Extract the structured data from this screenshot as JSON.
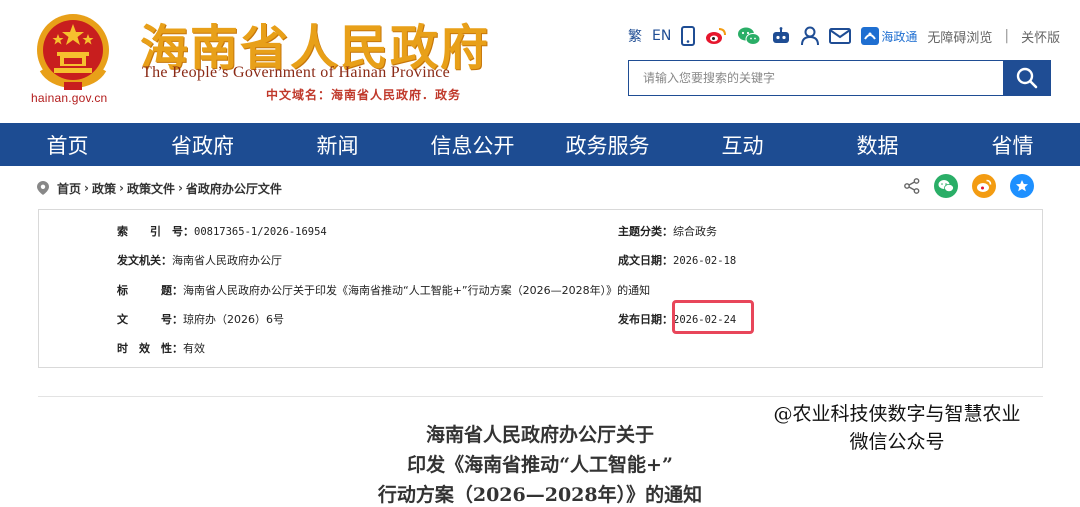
{
  "header": {
    "domain": "hainan.gov.cn",
    "brand_cn": "海南省人民政府",
    "brand_en": "The People’s Government  of Hainan Province",
    "cn_domain": "中文域名：海南省人民政府．政务",
    "toolbar": {
      "traditional": "繁",
      "english": "EN",
      "haizhengtong": "海政通",
      "accessible": "无障碍浏览",
      "separator": "|",
      "elder": "关怀版"
    },
    "search": {
      "placeholder": "请输入您要搜索的关键字"
    }
  },
  "nav": {
    "items": [
      "首页",
      "省政府",
      "新闻",
      "信息公开",
      "政务服务",
      "互动",
      "数据",
      "省情"
    ]
  },
  "breadcrumb": {
    "items": [
      "首页",
      "政策",
      "政策文件",
      "省政府办公厅文件"
    ],
    "arrow": "›"
  },
  "meta": {
    "index_label": "索　　引　号：",
    "index_value": "00817365-1/2026-16954",
    "issuer_label": "发文机关：",
    "issuer_value": "海南省人民政府办公厅",
    "title_label": "标　　　题：",
    "title_value": "海南省人民政府办公厅关于印发《海南省推动“人工智能+”行动方案（2026—2028年）》的通知",
    "docno_label": "文　　　号：",
    "docno_value": "琼府办（2026）6号",
    "validity_label": "时　效　性：",
    "validity_value": "有效",
    "topic_label": "主题分类：",
    "topic_value": "综合政务",
    "created_label": "成文日期：",
    "created_value": "2026-02-18",
    "published_label": "发布日期：",
    "published_value": "2026-02-24",
    "highlight_color": "#e8465a"
  },
  "document": {
    "title_lines": [
      "海南省人民政府办公厅关于",
      "印发《海南省推动“人工智能+”",
      "行动方案（2026—2028年）》的通知"
    ]
  },
  "watermark": {
    "line1": "@农业科技侠数字与智慧农业",
    "line2": "微信公众号"
  },
  "colors": {
    "nav_bg": "#1d4c92",
    "brand": "#e8a019",
    "emblem_red": "#c81e1e"
  }
}
